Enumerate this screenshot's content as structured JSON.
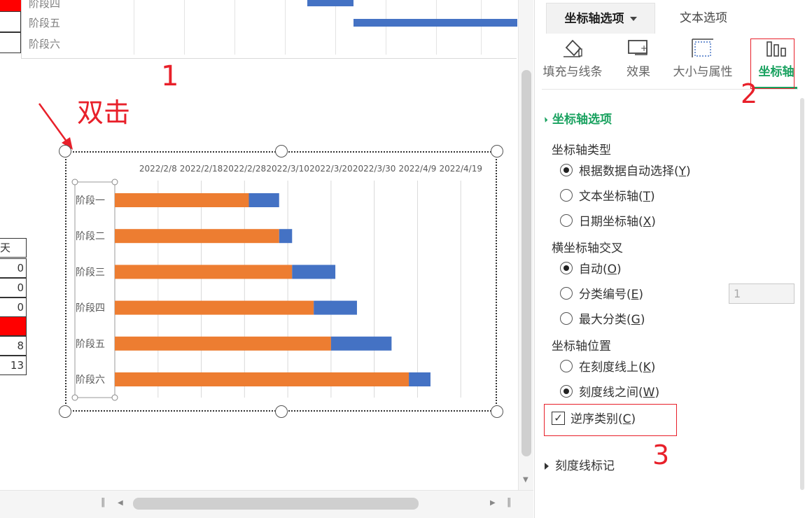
{
  "sheet": {
    "top_chart_labels": [
      "阶段四",
      "阶段五",
      "阶段六"
    ],
    "left_cells": [
      "天",
      "0",
      "0",
      "0",
      "",
      "8",
      "13"
    ]
  },
  "annotations": {
    "num1": "1",
    "double_click": "双击",
    "num2": "2",
    "num3": "3"
  },
  "colors": {
    "duration_bar": "#ed7d31",
    "remaining_bar": "#4472c4",
    "accent": "#1aa260",
    "annotation": "#e8202a"
  },
  "chart_data": {
    "type": "bar",
    "orientation": "horizontal",
    "stacked": true,
    "title": "",
    "categories": [
      "阶段一",
      "阶段二",
      "阶段三",
      "阶段四",
      "阶段五",
      "阶段六"
    ],
    "x_tick_labels": [
      "2022/2/8",
      "2022/2/18",
      "2022/2/28",
      "2022/3/10",
      "2022/3/20",
      "2022/3/30",
      "2022/4/9",
      "2022/4/19"
    ],
    "x_axis_position": "top",
    "xlim": [
      "2022/1/29",
      "2022/4/29"
    ],
    "grid": true,
    "legend": "none",
    "series": [
      {
        "values_end_dates": [
          "2022/3/1",
          "2022/3/8",
          "2022/3/11",
          "2022/3/16",
          "2022/3/20",
          "2022/4/7"
        ]
      },
      {
        "values_end_dates": [
          "2022/3/8",
          "2022/3/11",
          "2022/3/21",
          "2022/3/26",
          "2022/4/3",
          "2022/4/12"
        ]
      }
    ]
  },
  "panel": {
    "tab_axis": "坐标轴选项",
    "tab_text": "文本选项",
    "categories": {
      "fill": "填充与线条",
      "effect": "效果",
      "size": "大小与属性",
      "axis": "坐标轴"
    },
    "section_title": "坐标轴选项",
    "axis_type": {
      "label": "坐标轴类型",
      "options": [
        "根据数据自动选择(",
        "文本坐标轴(",
        "日期坐标轴("
      ],
      "keys": [
        "Y",
        "T",
        "X"
      ],
      "selected": 0
    },
    "cross": {
      "label": "横坐标轴交叉",
      "options": [
        "自动(",
        "分类编号(",
        "最大分类("
      ],
      "keys": [
        "O",
        "E",
        "G"
      ],
      "selected": 0,
      "category_number_value": "1"
    },
    "position": {
      "label": "坐标轴位置",
      "options": [
        "在刻度线上(",
        "刻度线之间("
      ],
      "keys": [
        "K",
        "W"
      ],
      "selected": 1
    },
    "reverse": {
      "label": "逆序类别(",
      "key": "C",
      "checked": true
    },
    "tick_marks": "刻度线标记"
  }
}
